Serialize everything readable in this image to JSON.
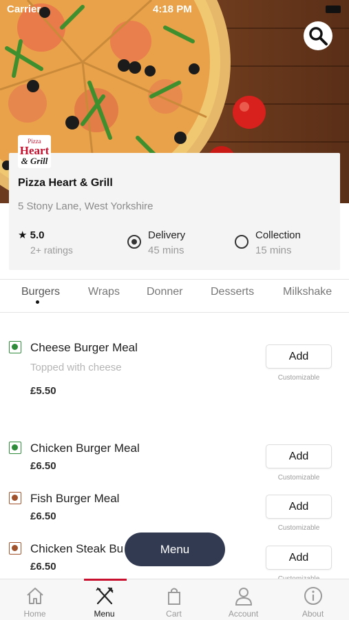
{
  "status_bar": {
    "carrier": "Carrier",
    "time": "4:18 PM"
  },
  "restaurant": {
    "logo": {
      "line1": "Pizza",
      "line2": "Heart",
      "line3": "& Grill"
    },
    "name": "Pizza Heart & Grill",
    "address": "5 Stony Lane, West Yorkshire",
    "rating": "5.0",
    "rating_count": "2+ ratings",
    "delivery": {
      "title": "Delivery",
      "time": "45 mins",
      "selected": true
    },
    "collection": {
      "title": "Collection",
      "time": "15 mins",
      "selected": false
    }
  },
  "categories": [
    "Burgers",
    "Wraps",
    "Donner",
    "Desserts",
    "Milkshake"
  ],
  "active_category": "Burgers",
  "items": [
    {
      "name": "Cheese Burger Meal",
      "description": "Topped with cheese",
      "price": "£5.50",
      "indicator": "green",
      "add": "Add",
      "note": "Customizable"
    },
    {
      "name": "Chicken Burger Meal",
      "price": "£6.50",
      "indicator": "green",
      "add": "Add",
      "note": "Customizable"
    },
    {
      "name": "Fish Burger Meal",
      "price": "£6.50",
      "indicator": "brown",
      "add": "Add",
      "note": "Customizable"
    },
    {
      "name": "Chicken Steak Bu",
      "price": "£6.50",
      "indicator": "brown",
      "add": "Add",
      "note": "Customizable"
    }
  ],
  "float_menu_label": "Menu",
  "bottom_nav": [
    {
      "label": "Home",
      "icon": "home-icon"
    },
    {
      "label": "Menu",
      "icon": "fork-knife-icon",
      "active": true
    },
    {
      "label": "Cart",
      "icon": "bag-icon"
    },
    {
      "label": "Account",
      "icon": "user-icon"
    },
    {
      "label": "About",
      "icon": "info-icon"
    }
  ],
  "colors": {
    "accent": "#c8102e",
    "float_button": "#323a52",
    "veg_green": "#2e8b3a",
    "nonveg_brown": "#a0522d"
  }
}
